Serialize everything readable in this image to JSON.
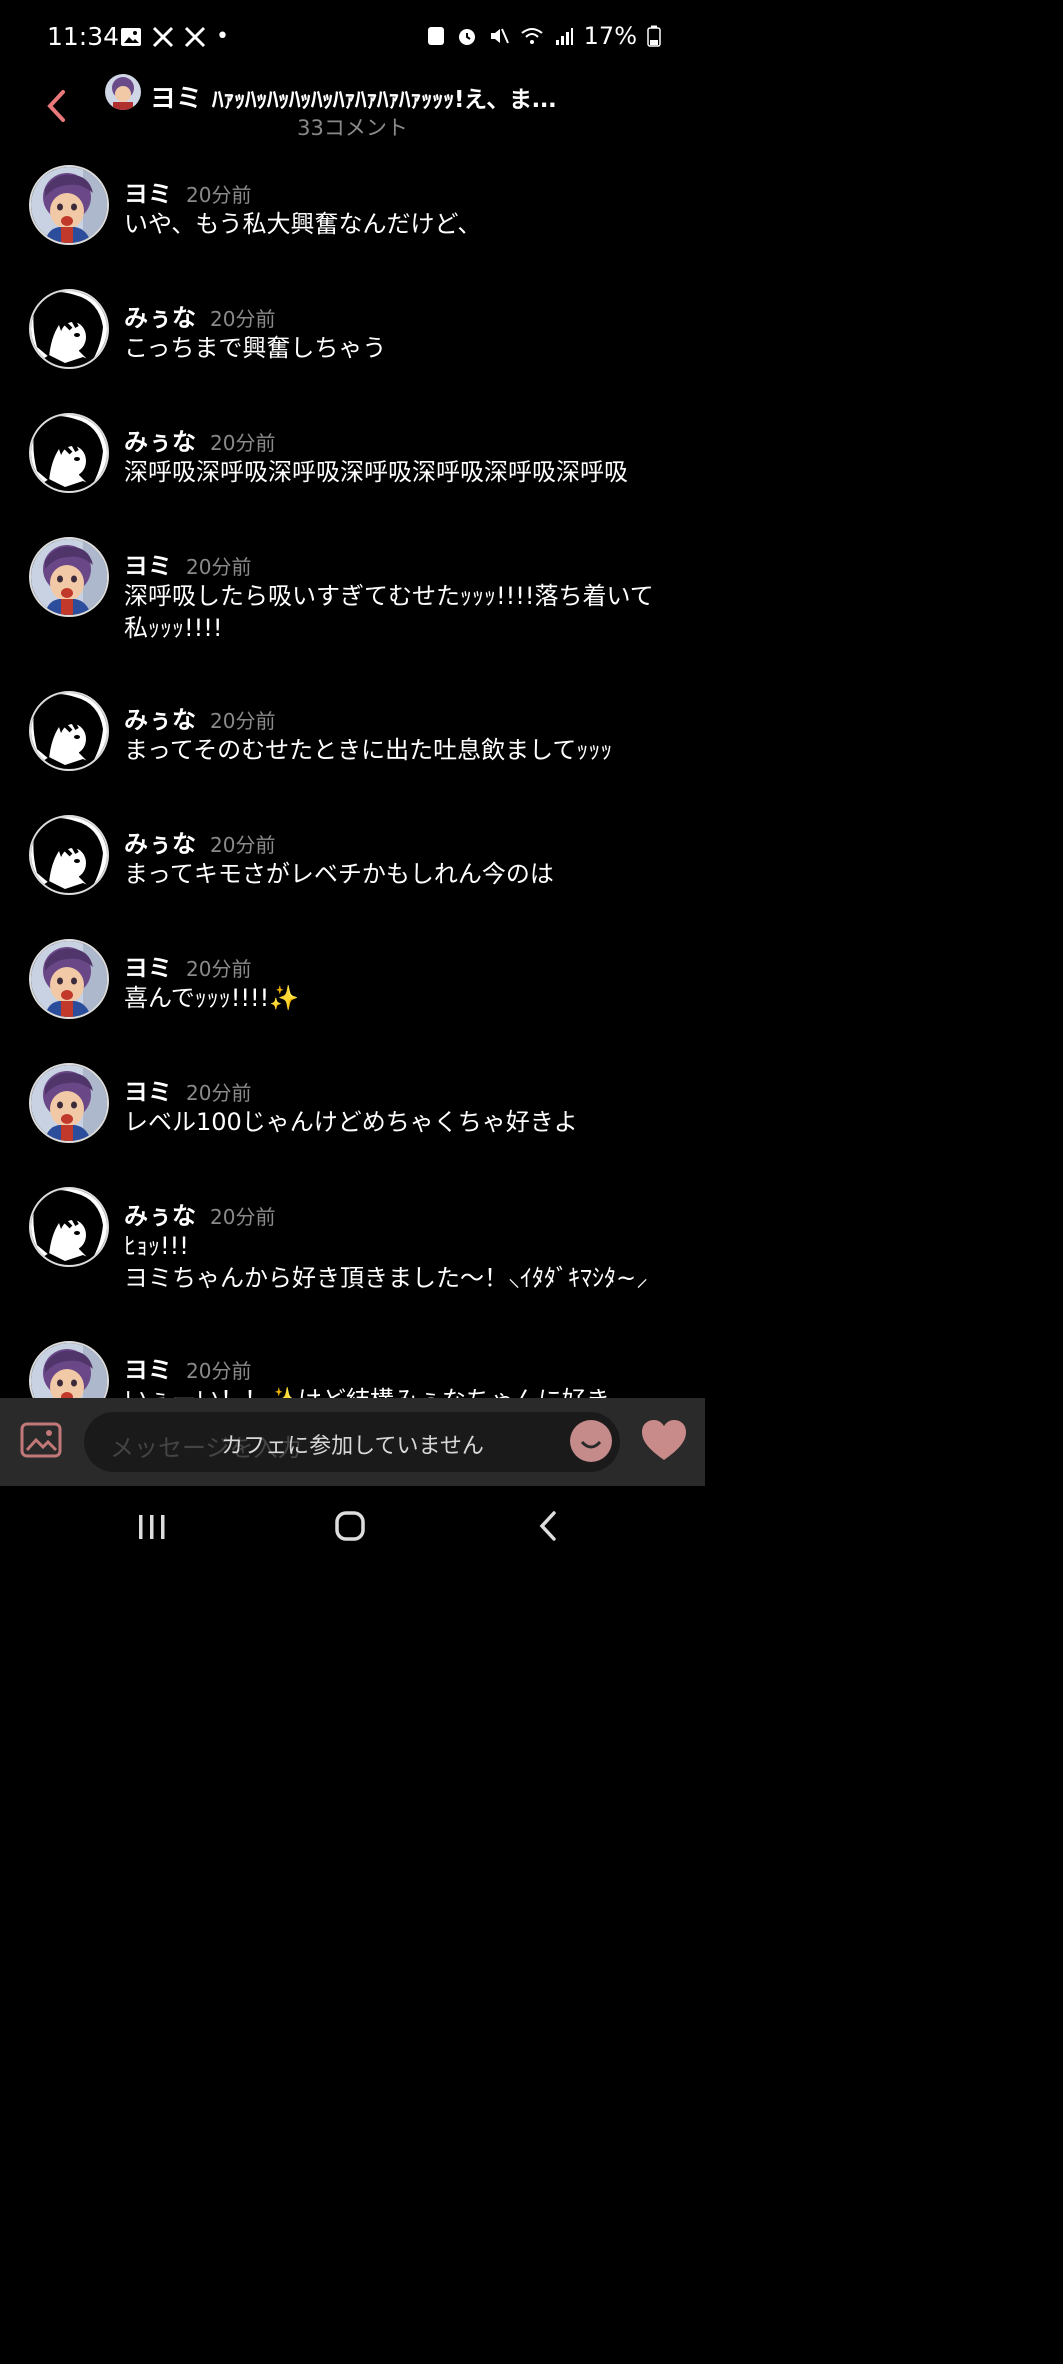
{
  "status_bar": {
    "time": "11:34",
    "dot": "•",
    "battery": "17%"
  },
  "header": {
    "user": "ヨミ",
    "title": "ﾊｧｯﾊｯﾊｯﾊｯﾊｯﾊｧﾊｧﾊｧﾊｧｯｯｯ!え、ま...",
    "comment_count": "33コメント"
  },
  "comments": [
    {
      "name": "ヨミ",
      "avatar": "yomi",
      "time": "20分前",
      "text": "いや、もう私大興奮なんだけど、"
    },
    {
      "name": "みぅな",
      "avatar": "miuna",
      "time": "20分前",
      "text": "こっちまで興奮しちゃう"
    },
    {
      "name": "みぅな",
      "avatar": "miuna",
      "time": "20分前",
      "text": "深呼吸深呼吸深呼吸深呼吸深呼吸深呼吸深呼吸"
    },
    {
      "name": "ヨミ",
      "avatar": "yomi",
      "time": "20分前",
      "text": "深呼吸したら吸いすぎてむせたｯｯｯ!!!!落ち着いて\n私ｯｯｯ!!!!"
    },
    {
      "name": "みぅな",
      "avatar": "miuna",
      "time": "20分前",
      "text": "まってそのむせたときに出た吐息飲ましてｯｯｯ"
    },
    {
      "name": "みぅな",
      "avatar": "miuna",
      "time": "20分前",
      "text": "まってキモさがレベチかもしれん今のは"
    },
    {
      "name": "ヨミ",
      "avatar": "yomi",
      "time": "20分前",
      "text": "喜んでｯｯｯ!!!!✨"
    },
    {
      "name": "ヨミ",
      "avatar": "yomi",
      "time": "20分前",
      "text": "レベル100じゃんけどめちゃくちゃ好きよ"
    },
    {
      "name": "みぅな",
      "avatar": "miuna",
      "time": "20分前",
      "text": "ﾋｮｯ!!!\nヨミちゃんから好き頂きました〜！⸜ｲﾀﾀﾞｷﾏｼﾀ~⸝"
    },
    {
      "name": "ヨミ",
      "avatar": "yomi",
      "time": "20分前",
      "text": "いぇーい！！✨けど結構みぅなちゃんに好き"
    }
  ],
  "input": {
    "placeholder": "メッセージを入力",
    "overlay": "カフェに参加していません"
  },
  "colors": {
    "accent": "#e8787a",
    "background": "#000000",
    "muted": "#8a8a8a",
    "bar": "#2a2a2a"
  },
  "icons": [
    "image-icon",
    "x-icon",
    "back-icon",
    "emoji-icon",
    "heart-icon",
    "recents-icon",
    "home-icon"
  ]
}
